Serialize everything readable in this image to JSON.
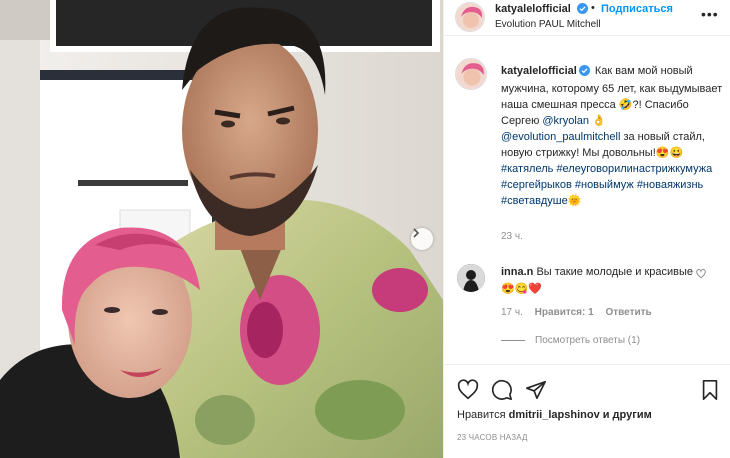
{
  "post": {
    "username": "katyalelofficial",
    "follow_label": "Подписаться",
    "separator": "•",
    "location": "Evolution PAUL Mitchell",
    "more_label": "•••",
    "caption": {
      "username": "katyalelofficial",
      "parts": [
        {
          "type": "text",
          "value": " Как вам мой новый мужчина, которому 65 лет, как выдумывает наша смешная пресса 🤣?! Спасибо Сергею "
        },
        {
          "type": "mention",
          "value": "@kryolan"
        },
        {
          "type": "text",
          "value": " 👌 "
        },
        {
          "type": "mention",
          "value": "@evolution_paulmitchell"
        },
        {
          "type": "text",
          "value": " за новый стайл, новую стрижку! Мы довольны!😍😀 "
        },
        {
          "type": "tag",
          "value": "#катялель"
        },
        {
          "type": "text",
          "value": " "
        },
        {
          "type": "tag",
          "value": "#елеуговорилинастрижкумужа"
        },
        {
          "type": "text",
          "value": " "
        },
        {
          "type": "tag",
          "value": "#сергейрыков"
        },
        {
          "type": "text",
          "value": " "
        },
        {
          "type": "tag",
          "value": "#новыймуж"
        },
        {
          "type": "text",
          "value": " "
        },
        {
          "type": "tag",
          "value": "#новаяжизнь"
        },
        {
          "type": "text",
          "value": " "
        },
        {
          "type": "tag",
          "value": "#светавдуше"
        },
        {
          "type": "text",
          "value": "🌞"
        }
      ],
      "time": "23 ч."
    },
    "comment": {
      "username": "inna.n",
      "text": " Вы такие молодые и красивые😍😋❤️",
      "time": "17 ч.",
      "likes": "Нравится: 1",
      "reply_label": "Ответить",
      "view_replies": "Посмотреть ответы (1)"
    },
    "likes": {
      "prefix": "Нравится ",
      "user": "dmitrii_lapshinov",
      "suffix": " и другим"
    },
    "post_time": "23 ЧАСОВ НАЗАД"
  },
  "colors": {
    "accent": "#0095f6",
    "link": "#00376b",
    "muted": "#8e8e8e",
    "verified": "#3897f0"
  },
  "icons": [
    "verified-badge-icon",
    "heart-icon",
    "comment-icon",
    "share-icon",
    "bookmark-icon",
    "next-arrow-icon"
  ]
}
